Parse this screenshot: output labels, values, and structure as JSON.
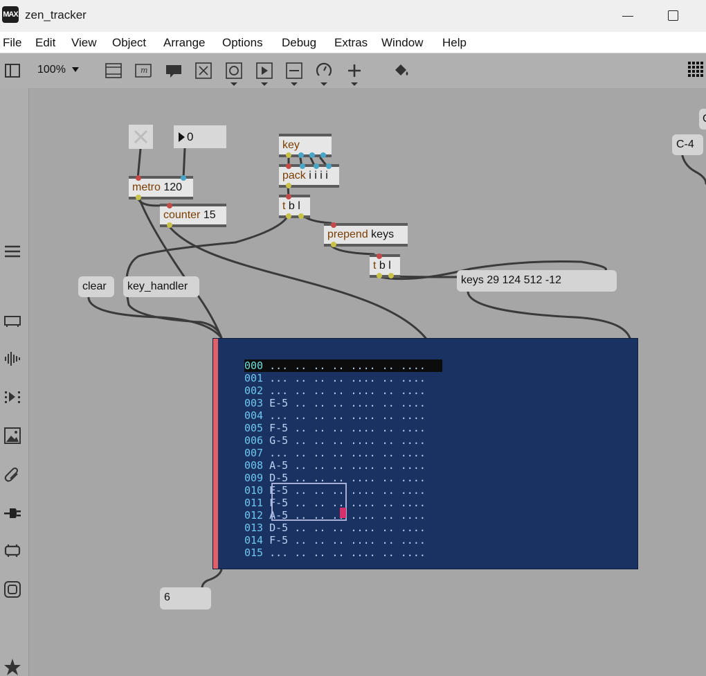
{
  "window": {
    "title": "zen_tracker",
    "logo_text": "MAX"
  },
  "menu": [
    "File",
    "Edit",
    "View",
    "Object",
    "Arrange",
    "Options",
    "Debug",
    "Extras",
    "Window",
    "Help"
  ],
  "toolbar": {
    "zoom": "100%",
    "icons": [
      "presentation-icon",
      "comment-icon",
      "speech-bubble-icon",
      "toggle-icon",
      "button-icon",
      "play-icon",
      "slider-icon",
      "dial-icon",
      "plus-icon",
      "paint-bucket-icon",
      "grid-icon"
    ]
  },
  "sidebar": {
    "icons": [
      "menu-icon",
      "inspector-icon",
      "audio-icon",
      "playback-icon",
      "image-icon",
      "attachment-icon",
      "plug-icon",
      "object-icon",
      "square-icon",
      "star-icon"
    ]
  },
  "patch": {
    "number_value": "0",
    "objects": {
      "metro": {
        "cls": "metro",
        "arg": "120"
      },
      "counter": {
        "cls": "counter",
        "arg": "15"
      },
      "key": {
        "cls": "key",
        "arg": ""
      },
      "pack": {
        "cls": "pack",
        "arg": "i i i i"
      },
      "trigger1": {
        "cls": "t",
        "arg": "b l"
      },
      "prepend": {
        "cls": "prepend",
        "arg": "keys"
      },
      "trigger2": {
        "cls": "t",
        "arg": "b l"
      }
    },
    "messages": {
      "clear": "clear",
      "key_handler": "key_handler",
      "keys": "keys 29 124 512 -12",
      "note": "C-4",
      "output": "6",
      "partial": "C"
    }
  },
  "tracker": {
    "rows": [
      {
        "num": "000",
        "cells": "... .. .. .. .... .. ...."
      },
      {
        "num": "001",
        "cells": "... .. .. .. .... .. ...."
      },
      {
        "num": "002",
        "cells": "... .. .. .. .... .. ...."
      },
      {
        "num": "003",
        "cells": "E-5 .. .. .. .... .. ...."
      },
      {
        "num": "004",
        "cells": "... .. .. .. .... .. ...."
      },
      {
        "num": "005",
        "cells": "F-5 .. .. .. .... .. ...."
      },
      {
        "num": "006",
        "cells": "G-5 .. .. .. .... .. ...."
      },
      {
        "num": "007",
        "cells": "... .. .. .. .... .. ...."
      },
      {
        "num": "008",
        "cells": "A-5 .. .. .. .... .. ...."
      },
      {
        "num": "009",
        "cells": "D-5 .. .. .. .... .. ...."
      },
      {
        "num": "010",
        "cells": "E-5 .. .. .. .... .. ...."
      },
      {
        "num": "011",
        "cells": "F-5 .. .. .. .... .. ...."
      },
      {
        "num": "012",
        "cells": "A-5 .. .. .. .... .. ...."
      },
      {
        "num": "013",
        "cells": "D-5 .. .. .. .... .. ...."
      },
      {
        "num": "014",
        "cells": "F-5 .. .. .. .... .. ...."
      },
      {
        "num": "015",
        "cells": "... .. .. .. .... .. ...."
      }
    ]
  }
}
